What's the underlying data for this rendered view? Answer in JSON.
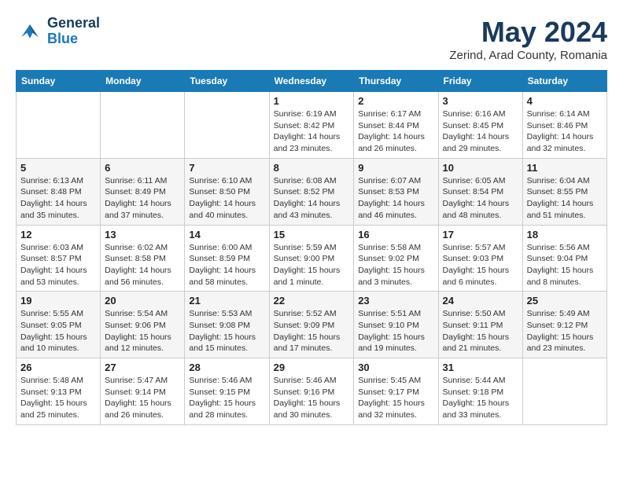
{
  "logo": {
    "line1": "General",
    "line2": "Blue"
  },
  "title": "May 2024",
  "subtitle": "Zerind, Arad County, Romania",
  "days_of_week": [
    "Sunday",
    "Monday",
    "Tuesday",
    "Wednesday",
    "Thursday",
    "Friday",
    "Saturday"
  ],
  "weeks": [
    [
      {
        "day": "",
        "info": ""
      },
      {
        "day": "",
        "info": ""
      },
      {
        "day": "",
        "info": ""
      },
      {
        "day": "1",
        "info": "Sunrise: 6:19 AM\nSunset: 8:42 PM\nDaylight: 14 hours\nand 23 minutes."
      },
      {
        "day": "2",
        "info": "Sunrise: 6:17 AM\nSunset: 8:44 PM\nDaylight: 14 hours\nand 26 minutes."
      },
      {
        "day": "3",
        "info": "Sunrise: 6:16 AM\nSunset: 8:45 PM\nDaylight: 14 hours\nand 29 minutes."
      },
      {
        "day": "4",
        "info": "Sunrise: 6:14 AM\nSunset: 8:46 PM\nDaylight: 14 hours\nand 32 minutes."
      }
    ],
    [
      {
        "day": "5",
        "info": "Sunrise: 6:13 AM\nSunset: 8:48 PM\nDaylight: 14 hours\nand 35 minutes."
      },
      {
        "day": "6",
        "info": "Sunrise: 6:11 AM\nSunset: 8:49 PM\nDaylight: 14 hours\nand 37 minutes."
      },
      {
        "day": "7",
        "info": "Sunrise: 6:10 AM\nSunset: 8:50 PM\nDaylight: 14 hours\nand 40 minutes."
      },
      {
        "day": "8",
        "info": "Sunrise: 6:08 AM\nSunset: 8:52 PM\nDaylight: 14 hours\nand 43 minutes."
      },
      {
        "day": "9",
        "info": "Sunrise: 6:07 AM\nSunset: 8:53 PM\nDaylight: 14 hours\nand 46 minutes."
      },
      {
        "day": "10",
        "info": "Sunrise: 6:05 AM\nSunset: 8:54 PM\nDaylight: 14 hours\nand 48 minutes."
      },
      {
        "day": "11",
        "info": "Sunrise: 6:04 AM\nSunset: 8:55 PM\nDaylight: 14 hours\nand 51 minutes."
      }
    ],
    [
      {
        "day": "12",
        "info": "Sunrise: 6:03 AM\nSunset: 8:57 PM\nDaylight: 14 hours\nand 53 minutes."
      },
      {
        "day": "13",
        "info": "Sunrise: 6:02 AM\nSunset: 8:58 PM\nDaylight: 14 hours\nand 56 minutes."
      },
      {
        "day": "14",
        "info": "Sunrise: 6:00 AM\nSunset: 8:59 PM\nDaylight: 14 hours\nand 58 minutes."
      },
      {
        "day": "15",
        "info": "Sunrise: 5:59 AM\nSunset: 9:00 PM\nDaylight: 15 hours\nand 1 minute."
      },
      {
        "day": "16",
        "info": "Sunrise: 5:58 AM\nSunset: 9:02 PM\nDaylight: 15 hours\nand 3 minutes."
      },
      {
        "day": "17",
        "info": "Sunrise: 5:57 AM\nSunset: 9:03 PM\nDaylight: 15 hours\nand 6 minutes."
      },
      {
        "day": "18",
        "info": "Sunrise: 5:56 AM\nSunset: 9:04 PM\nDaylight: 15 hours\nand 8 minutes."
      }
    ],
    [
      {
        "day": "19",
        "info": "Sunrise: 5:55 AM\nSunset: 9:05 PM\nDaylight: 15 hours\nand 10 minutes."
      },
      {
        "day": "20",
        "info": "Sunrise: 5:54 AM\nSunset: 9:06 PM\nDaylight: 15 hours\nand 12 minutes."
      },
      {
        "day": "21",
        "info": "Sunrise: 5:53 AM\nSunset: 9:08 PM\nDaylight: 15 hours\nand 15 minutes."
      },
      {
        "day": "22",
        "info": "Sunrise: 5:52 AM\nSunset: 9:09 PM\nDaylight: 15 hours\nand 17 minutes."
      },
      {
        "day": "23",
        "info": "Sunrise: 5:51 AM\nSunset: 9:10 PM\nDaylight: 15 hours\nand 19 minutes."
      },
      {
        "day": "24",
        "info": "Sunrise: 5:50 AM\nSunset: 9:11 PM\nDaylight: 15 hours\nand 21 minutes."
      },
      {
        "day": "25",
        "info": "Sunrise: 5:49 AM\nSunset: 9:12 PM\nDaylight: 15 hours\nand 23 minutes."
      }
    ],
    [
      {
        "day": "26",
        "info": "Sunrise: 5:48 AM\nSunset: 9:13 PM\nDaylight: 15 hours\nand 25 minutes."
      },
      {
        "day": "27",
        "info": "Sunrise: 5:47 AM\nSunset: 9:14 PM\nDaylight: 15 hours\nand 26 minutes."
      },
      {
        "day": "28",
        "info": "Sunrise: 5:46 AM\nSunset: 9:15 PM\nDaylight: 15 hours\nand 28 minutes."
      },
      {
        "day": "29",
        "info": "Sunrise: 5:46 AM\nSunset: 9:16 PM\nDaylight: 15 hours\nand 30 minutes."
      },
      {
        "day": "30",
        "info": "Sunrise: 5:45 AM\nSunset: 9:17 PM\nDaylight: 15 hours\nand 32 minutes."
      },
      {
        "day": "31",
        "info": "Sunrise: 5:44 AM\nSunset: 9:18 PM\nDaylight: 15 hours\nand 33 minutes."
      },
      {
        "day": "",
        "info": ""
      }
    ]
  ]
}
